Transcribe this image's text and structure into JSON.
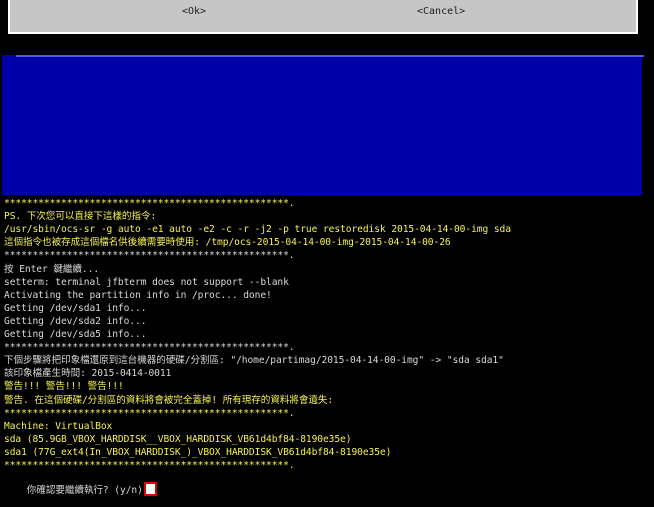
{
  "dialog": {
    "ok_label": "<Ok>",
    "cancel_label": "<Cancel>"
  },
  "colors": {
    "background": "#000000",
    "dialog": "#c6c6c6",
    "blue_panel": "#0000a8",
    "text_gray": "#d8d8d8",
    "text_yellow": "#f6f24e",
    "cursor_highlight": "#e00000"
  },
  "terminal": {
    "lines": [
      {
        "text": "**************************************************.",
        "color": "yellow"
      },
      {
        "text": "PS. 下次您可以直接下這樣的指令:",
        "color": "yellow"
      },
      {
        "text": "/usr/sbin/ocs-sr -g auto -e1 auto -e2 -c -r -j2 -p true restoredisk 2015-04-14-00-img sda",
        "color": "yellow"
      },
      {
        "text": "這個指令也被存成這個檔名供後續需要時使用: /tmp/ocs-2015-04-14-00-img-2015-04-14-00-26",
        "color": "yellow"
      },
      {
        "text": "**************************************************.",
        "color": "gray"
      },
      {
        "text": "按 Enter 鍵繼續...",
        "color": "gray"
      },
      {
        "text": "setterm: terminal jfbterm does not support --blank",
        "color": "gray"
      },
      {
        "text": "Activating the partition info in /proc... done!",
        "color": "gray"
      },
      {
        "text": "Getting /dev/sda1 info...",
        "color": "gray"
      },
      {
        "text": "Getting /dev/sda2 info...",
        "color": "gray"
      },
      {
        "text": "Getting /dev/sda5 info...",
        "color": "gray"
      },
      {
        "text": "**************************************************.",
        "color": "gray"
      },
      {
        "text": "下個步驟將把印象檔還原到這台機器的硬碟/分割區: \"/home/partimag/2015-04-14-00-img\" -> \"sda sda1\"",
        "color": "gray"
      },
      {
        "text": "該印象檔產生時間: 2015-0414-0011",
        "color": "gray"
      },
      {
        "text": "警告!!! 警告!!! 警告!!!",
        "color": "yellow"
      },
      {
        "text": "警告. 在這個硬碟/分割區的資料將會被完全蓋掉! 所有現存的資料將會遺失:",
        "color": "yellow"
      },
      {
        "text": "**************************************************.",
        "color": "yellow"
      },
      {
        "text": "Machine: VirtualBox",
        "color": "yellow"
      },
      {
        "text": "sda (85.9GB_VBOX_HARDDISK__VBOX_HARDDISK_VB61d4bf84-8190e35e)",
        "color": "yellow"
      },
      {
        "text": "sda1 (77G_ext4(In_VBOX_HARDDISK_)_VBOX_HARDDISK_VB61d4bf84-8190e35e)",
        "color": "yellow"
      },
      {
        "text": "**************************************************.",
        "color": "yellow"
      }
    ],
    "prompt": "你確認要繼續執行? (y/n)"
  }
}
